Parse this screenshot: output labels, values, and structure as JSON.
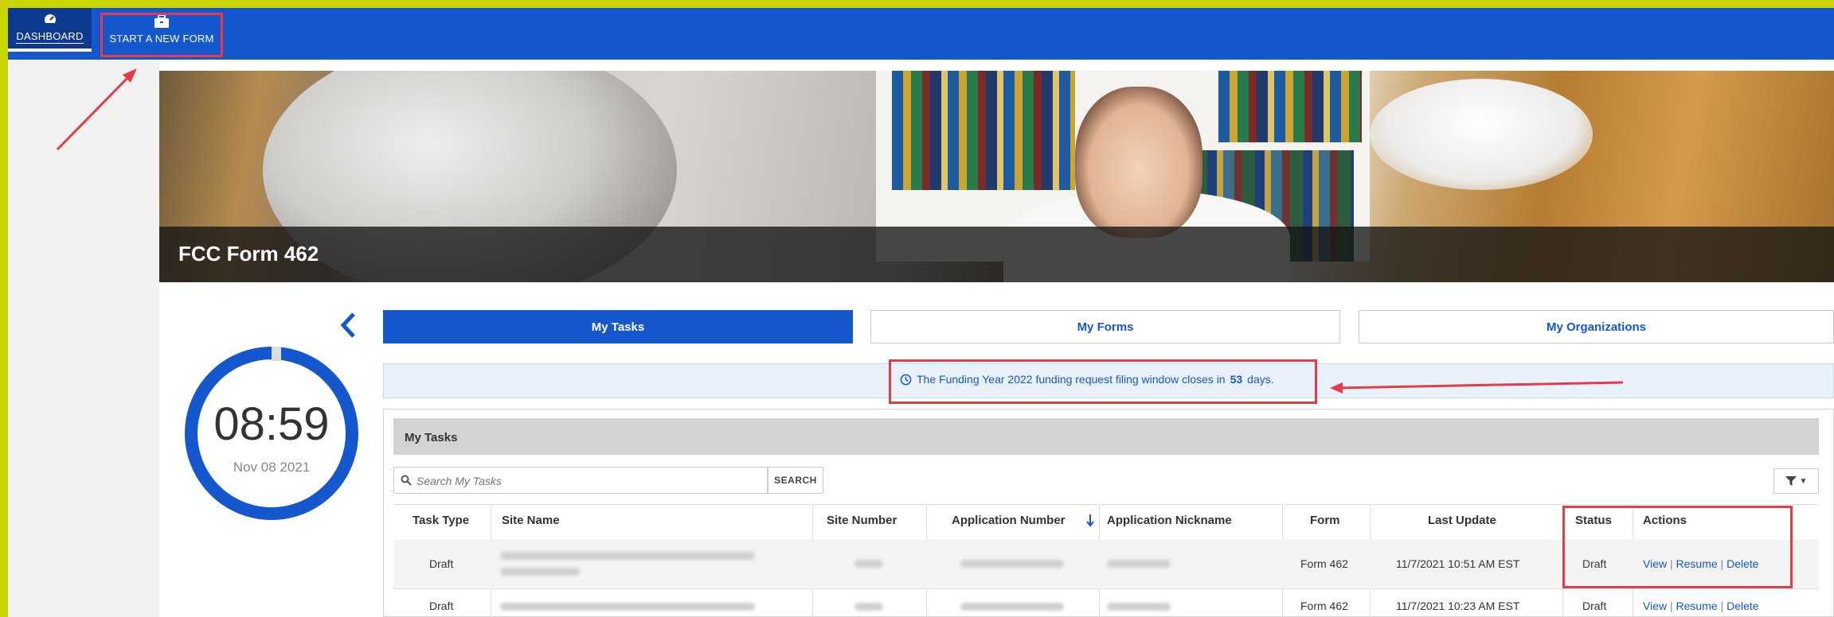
{
  "nav": {
    "dashboard_label": "DASHBOARD",
    "new_form_label": "START A NEW FORM"
  },
  "banner": {
    "title": "FCC Form 462"
  },
  "clock": {
    "time": "08:59",
    "date": "Nov 08 2021"
  },
  "tabs": [
    {
      "label": "My Tasks",
      "active": true
    },
    {
      "label": "My Forms",
      "active": false
    },
    {
      "label": "My Organizations",
      "active": false
    }
  ],
  "alert": {
    "prefix": "The Funding Year 2022 funding request filing window closes in",
    "days": "53",
    "suffix": "days."
  },
  "tasks": {
    "title": "My Tasks",
    "search_placeholder": "Search My Tasks",
    "search_button": "SEARCH",
    "columns": [
      "Task Type",
      "Site Name",
      "Site Number",
      "Application Number",
      "Application Nickname",
      "Form",
      "Last Update",
      "Status",
      "Actions"
    ],
    "rows": [
      {
        "task_type": "Draft",
        "form": "Form 462",
        "last_update": "11/7/2021 10:51 AM EST",
        "status": "Draft",
        "actions": [
          "View",
          "Resume",
          "Delete"
        ]
      },
      {
        "task_type": "Draft",
        "form": "Form 462",
        "last_update": "11/7/2021 10:23 AM EST",
        "status": "Draft",
        "actions": [
          "View",
          "Resume",
          "Delete"
        ]
      }
    ]
  },
  "colors": {
    "brand_blue": "#1557cd",
    "highlight_red": "#e43c48",
    "accent_green": "#c8d500"
  },
  "icons": [
    "dashboard-icon",
    "briefcase-icon",
    "chevron-left-icon",
    "clock-icon",
    "search-icon",
    "filter-icon",
    "sort-down-icon"
  ]
}
